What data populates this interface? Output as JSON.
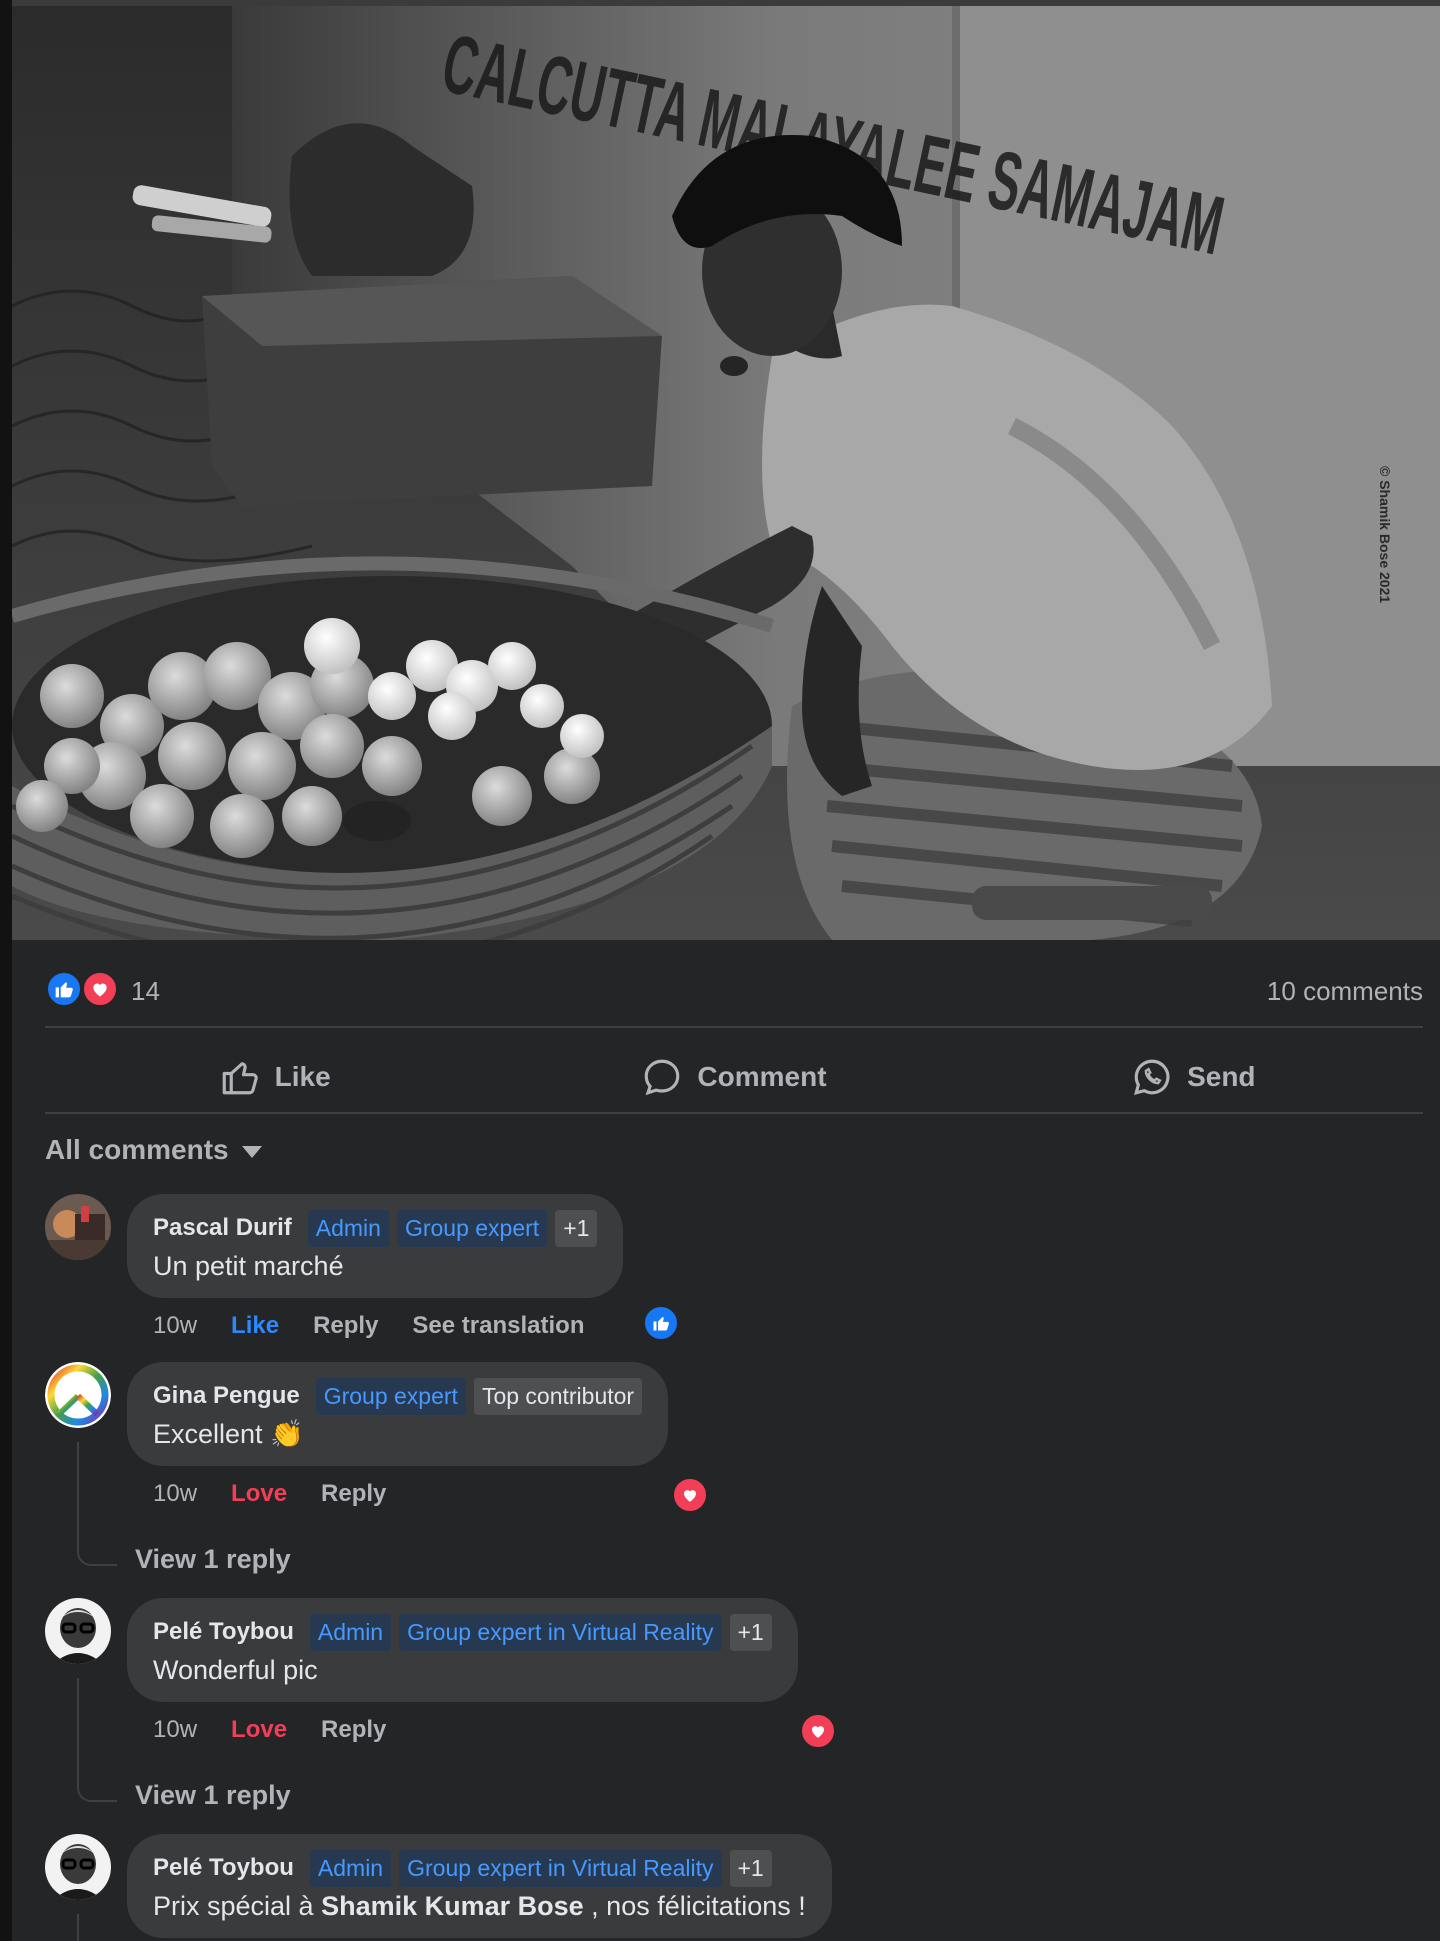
{
  "post": {
    "photo_alt": "Street vendor with basket of fruit",
    "watermark_signature": "© Shamik Bose 2021",
    "reaction_count": "14",
    "comment_count": "10 comments",
    "reaction_icons": [
      "like-icon",
      "love-icon"
    ]
  },
  "actions": {
    "like_label": "Like",
    "comment_label": "Comment",
    "send_label": "Send"
  },
  "comments_filter": {
    "label": "All comments"
  },
  "comments": [
    {
      "author": "Pascal Durif",
      "badges": [
        "Admin",
        "Group expert",
        "+1"
      ],
      "text": "Un petit marché",
      "age": "10w",
      "reaction_action": "Like",
      "reply_label": "Reply",
      "translate_label": "See translation",
      "reaction": "like"
    },
    {
      "author": "Gina Pengue",
      "badges": [
        "Group expert",
        "Top contributor"
      ],
      "text": "Excellent",
      "emoji": "👏",
      "age": "10w",
      "reaction_action": "Love",
      "reply_label": "Reply",
      "reaction": "love",
      "view_replies": "View 1 reply"
    },
    {
      "author": "Pelé Toybou",
      "badges": [
        "Admin",
        "Group expert in Virtual Reality",
        "+1"
      ],
      "text": "Wonderful pic",
      "age": "10w",
      "reaction_action": "Love",
      "reply_label": "Reply",
      "reaction": "love",
      "view_replies": "View 1 reply"
    },
    {
      "author": "Pelé Toybou",
      "badges": [
        "Admin",
        "Group expert in Virtual Reality",
        "+1"
      ],
      "text_prefix": "Prix spécial à ",
      "text_mention": "Shamik Kumar Bose",
      "text_suffix": " , nos félicitations !"
    }
  ],
  "colors": {
    "background": "#242526",
    "bubble": "#3a3b3c",
    "like_blue": "#2d88ff",
    "love_red": "#f33e58",
    "badge_text": "#4599ff",
    "muted_text": "#b0b3b8"
  }
}
